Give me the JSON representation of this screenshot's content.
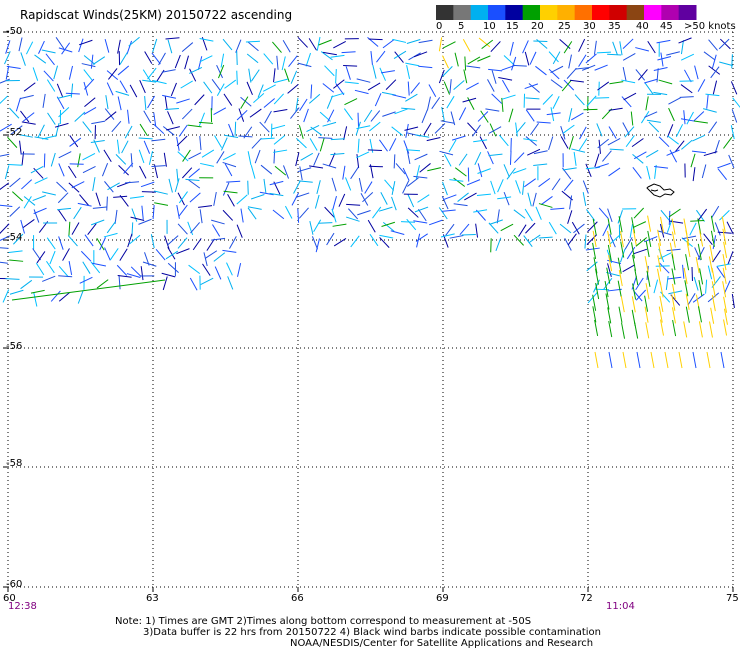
{
  "title": "Rapidscat Winds(25KM) 20150722 ascending",
  "legend": {
    "labels": [
      "0",
      "5",
      "10",
      "15",
      "20",
      "25",
      "30",
      "35",
      "40",
      "45",
      ">50 knots"
    ],
    "colors": [
      "#333333",
      "#777777",
      "#00b0f0",
      "#1a4fff",
      "#0000a0",
      "#00a000",
      "#ffd000",
      "#ffb000",
      "#ff7000",
      "#ff0000",
      "#d00000",
      "#8b4513",
      "#ff00ff",
      "#b000b0",
      "#6000a0"
    ]
  },
  "map": {
    "lat_labels": [
      "-50",
      "-52",
      "-54",
      "-56",
      "-58",
      "-60"
    ],
    "lon_labels": [
      "60",
      "63",
      "66",
      "69",
      "72",
      "75"
    ],
    "time_labels": [
      "12:38",
      "11:04"
    ]
  },
  "notes": {
    "line1": "Note: 1) Times are GMT 2)Times along bottom correspond to measurement at -50S",
    "line2": "3)Data buffer is 22 hrs from 20150722 4) Black wind barbs indicate possible contamination",
    "credit": "NOAA/NESDIS/Center for Satellite Applications and Research"
  }
}
